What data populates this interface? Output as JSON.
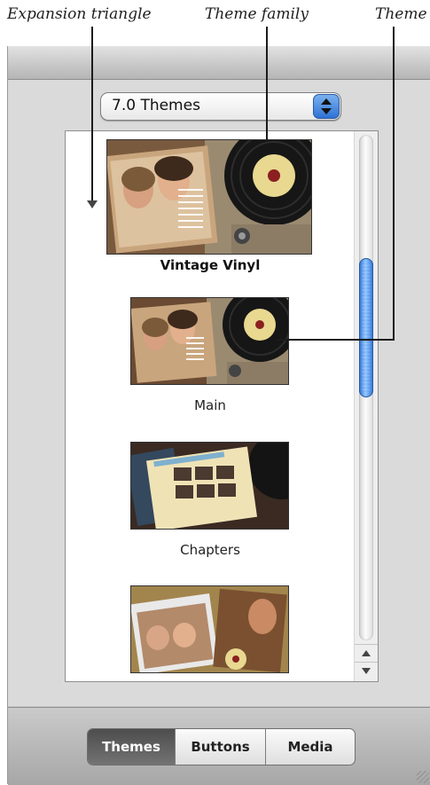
{
  "callouts": {
    "expansion_triangle": "Expansion triangle",
    "theme_family": "Theme family",
    "theme": "Theme"
  },
  "popup": {
    "value": "7.0 Themes"
  },
  "themes": {
    "family_name": "Vintage Vinyl",
    "items": [
      {
        "label": "Main"
      },
      {
        "label": "Chapters"
      },
      {
        "label": ""
      }
    ]
  },
  "tabs": {
    "items": [
      {
        "label": "Themes",
        "selected": true
      },
      {
        "label": "Buttons",
        "selected": false
      },
      {
        "label": "Media",
        "selected": false
      }
    ]
  },
  "colors": {
    "accent": "#2c6fd4",
    "window_panel": "#dadada",
    "selected_tab": "#5a5a5a"
  },
  "icons": {
    "expansion": "expansion-triangle-icon",
    "popup": "popup-stepper-icon",
    "resize": "resize-grip-icon"
  }
}
